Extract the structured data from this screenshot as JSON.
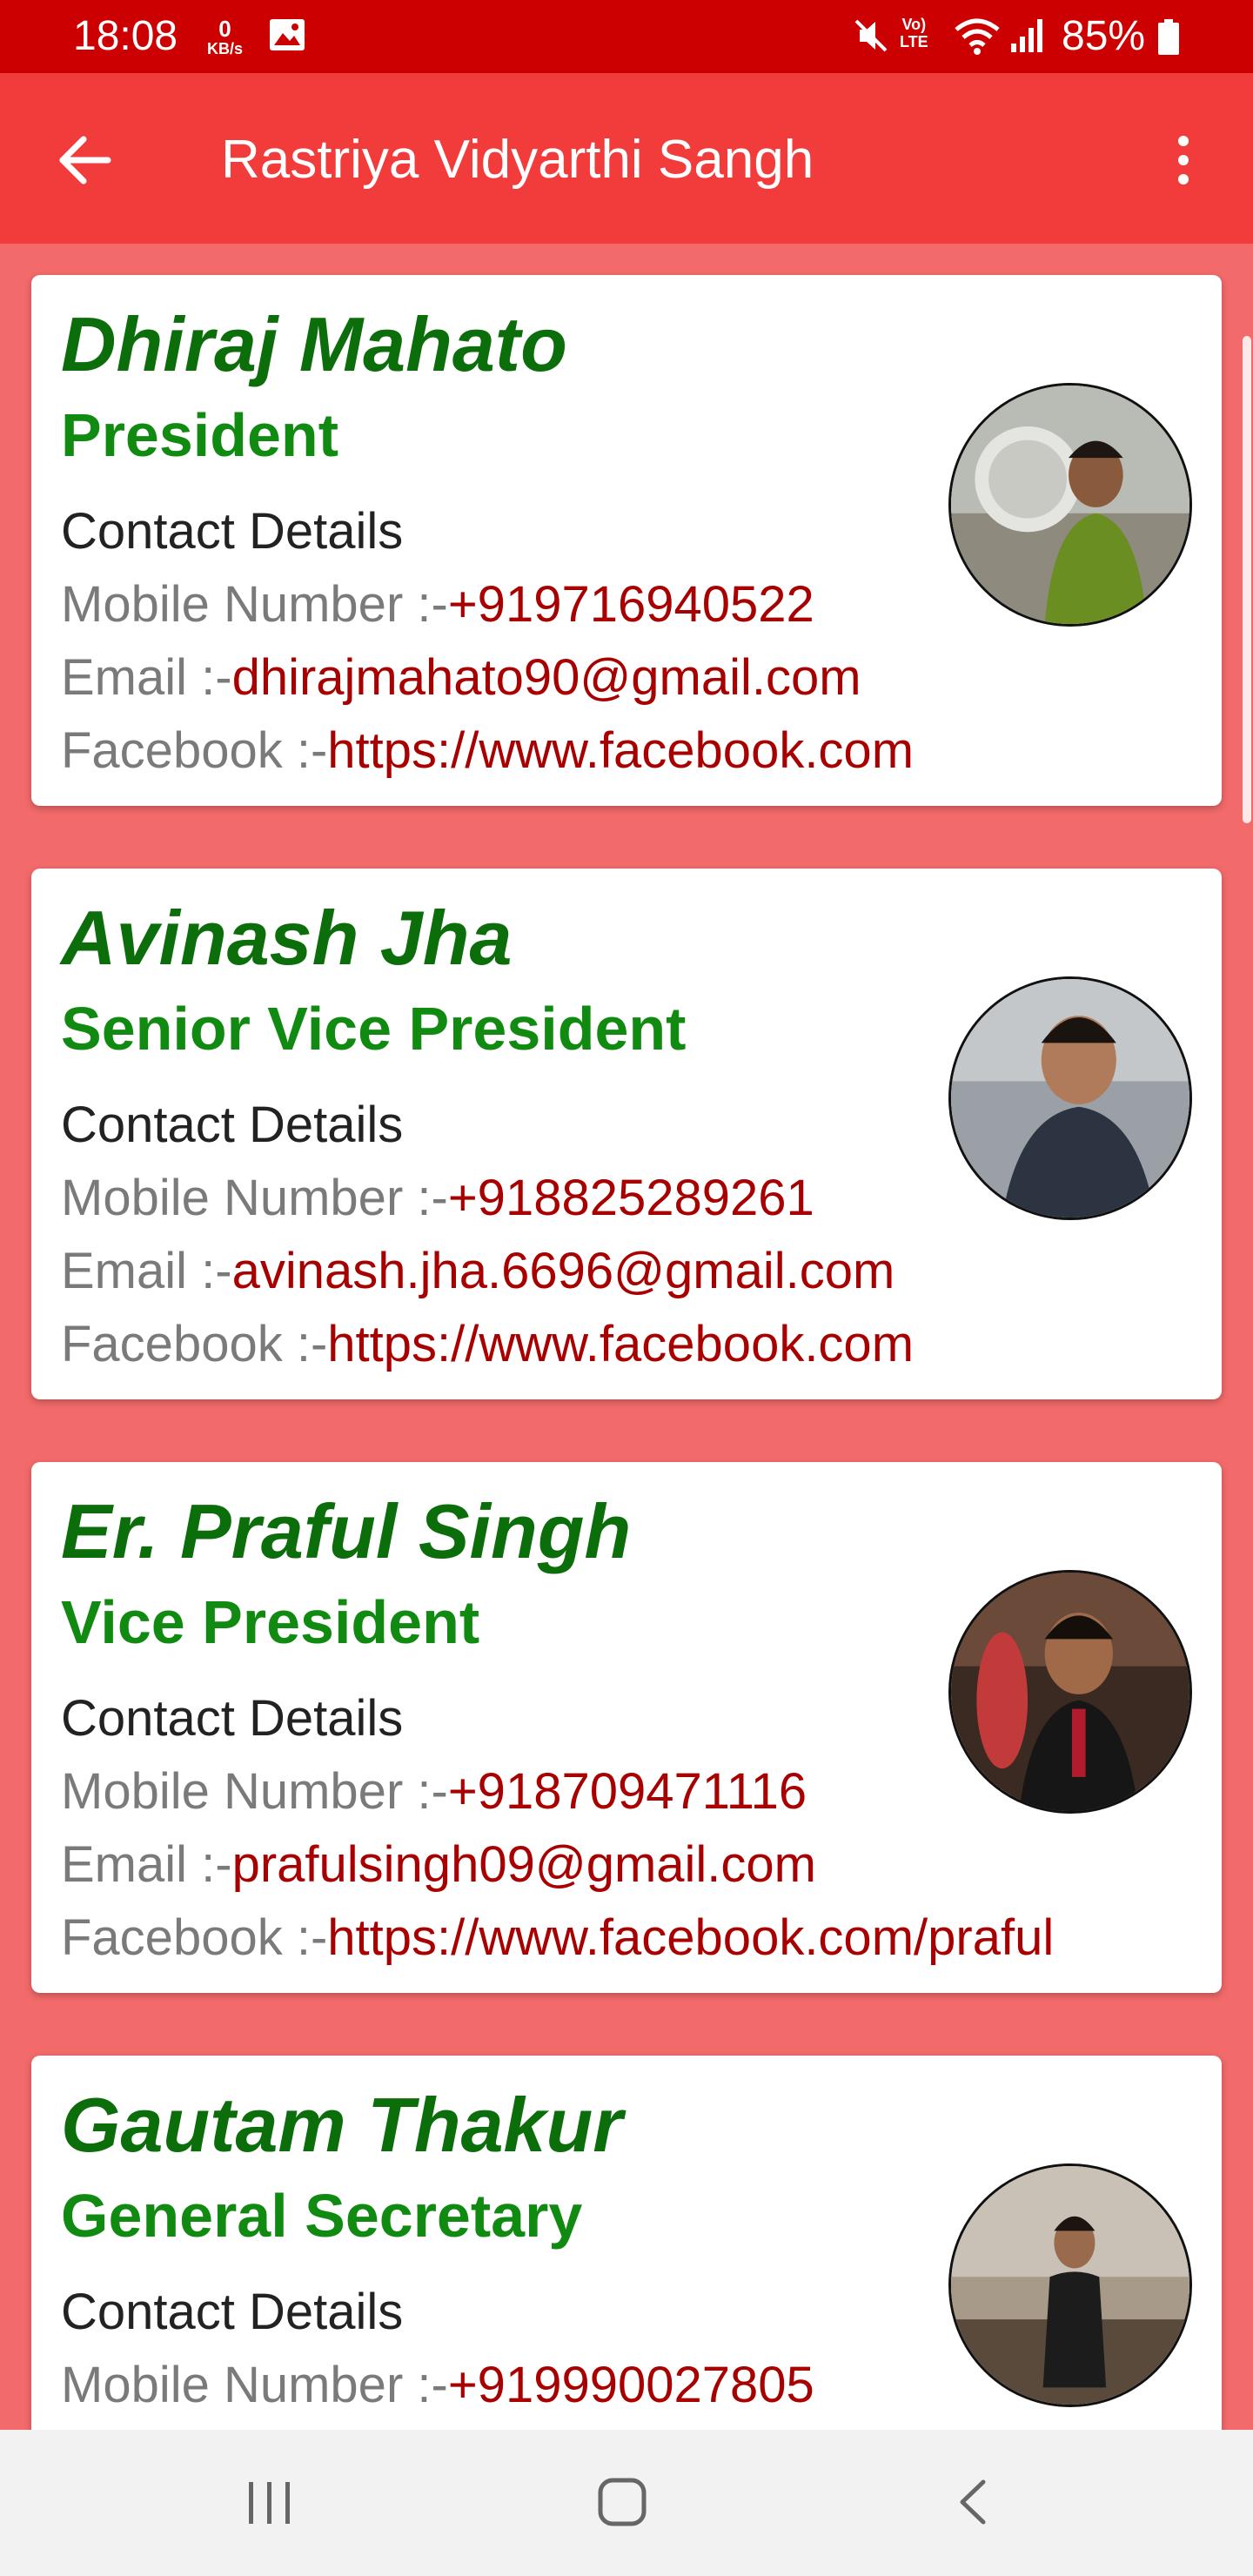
{
  "status_bar": {
    "time": "18:08",
    "speed_value": "0",
    "speed_unit": "KB/s",
    "volte_top": "Vo)",
    "volte_bottom": "LTE",
    "battery": "85%"
  },
  "app_bar": {
    "title": "Rastriya Vidyarthi Sangh"
  },
  "labels": {
    "contact_heading": "Contact Details",
    "mobile": "Mobile Number :-",
    "email": "Email :-",
    "facebook": "Facebook :-"
  },
  "members": [
    {
      "name": "Dhiraj Mahato",
      "role": "President",
      "mobile": "+919716940522",
      "email": "dhirajmahato90@gmail.com",
      "facebook": "https://www.facebook.com"
    },
    {
      "name": "Avinash Jha",
      "role": "Senior Vice President",
      "mobile": "+918825289261",
      "email": "avinash.jha.6696@gmail.com",
      "facebook": "https://www.facebook.com"
    },
    {
      "name": "Er. Praful Singh",
      "role": "Vice President",
      "mobile": "+918709471116",
      "email": "prafulsingh09@gmail.com",
      "facebook": "https://www.facebook.com/praful"
    },
    {
      "name": "Gautam Thakur",
      "role": "General Secretary",
      "mobile": "+919990027805",
      "email": "",
      "facebook": ""
    }
  ],
  "colors": {
    "status_bar": "#cc0000",
    "app_bar": "#f23b3b",
    "background": "#f26a6a",
    "name": "#0b6e0b",
    "role": "#118a11",
    "value": "#a80000"
  }
}
